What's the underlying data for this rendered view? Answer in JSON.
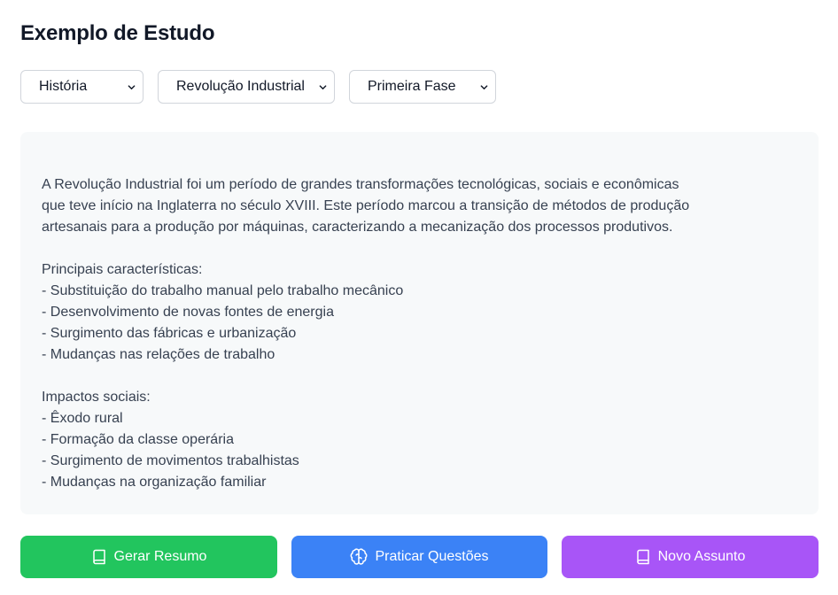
{
  "header": {
    "title": "Exemplo de Estudo"
  },
  "filters": {
    "subject": "História",
    "topic": "Revolução Industrial",
    "phase": "Primeira Fase"
  },
  "content": {
    "text": "A Revolução Industrial foi um período de grandes transformações tecnológicas, sociais e econômicas\nque teve início na Inglaterra no século XVIII. Este período marcou a transição de métodos de produção\nartesanais para a produção por máquinas, caracterizando a mecanização dos processos produtivos.\n\nPrincipais características:\n- Substituição do trabalho manual pelo trabalho mecânico\n- Desenvolvimento de novas fontes de energia\n- Surgimento das fábricas e urbanização\n- Mudanças nas relações de trabalho\n\nImpactos sociais:\n- Êxodo rural\n- Formação da classe operária\n- Surgimento de movimentos trabalhistas\n- Mudanças na organização familiar"
  },
  "actions": {
    "summary": {
      "label": "Gerar Resumo",
      "icon": "book-icon",
      "color": "#22c55e"
    },
    "practice": {
      "label": "Praticar Questões",
      "icon": "brain-icon",
      "color": "#3b82f6"
    },
    "new_topic": {
      "label": "Novo Assunto",
      "icon": "book-icon",
      "color": "#a855f7"
    }
  }
}
